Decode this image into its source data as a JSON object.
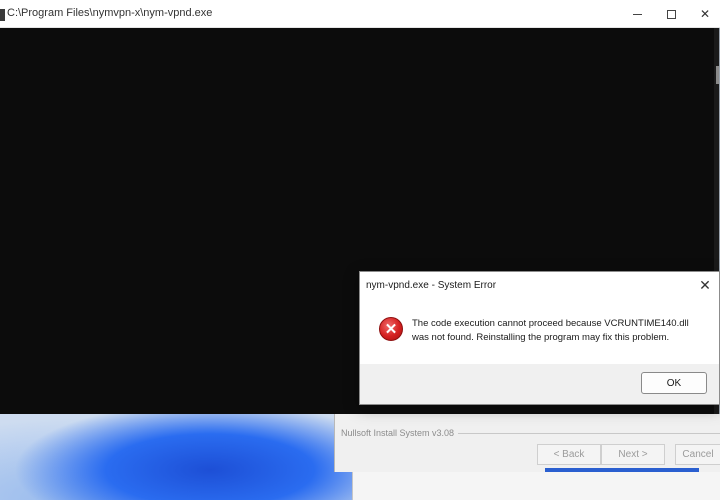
{
  "console": {
    "title": "C:\\Program Files\\nymvpn-x\\nym-vpnd.exe"
  },
  "installer": {
    "brand": "Nullsoft Install System v3.08",
    "back_label": "< Back",
    "next_label": "Next >",
    "cancel_label": "Cancel"
  },
  "dialog": {
    "title": "nym-vpnd.exe - System Error",
    "message": "The code execution cannot proceed because VCRUNTIME140.dll was not found. Reinstalling the program may fix this problem.",
    "ok_label": "OK",
    "icon": "error-icon",
    "close_glyph": "✕"
  },
  "window_controls": {
    "minimize_icon": "minimize-icon",
    "maximize_icon": "maximize-icon",
    "close_icon": "close-icon",
    "close_glyph": "✕"
  },
  "colors": {
    "console_bg": "#0c0c0c",
    "error_red": "#d42020",
    "installer_accent": "#2a5fd0"
  }
}
